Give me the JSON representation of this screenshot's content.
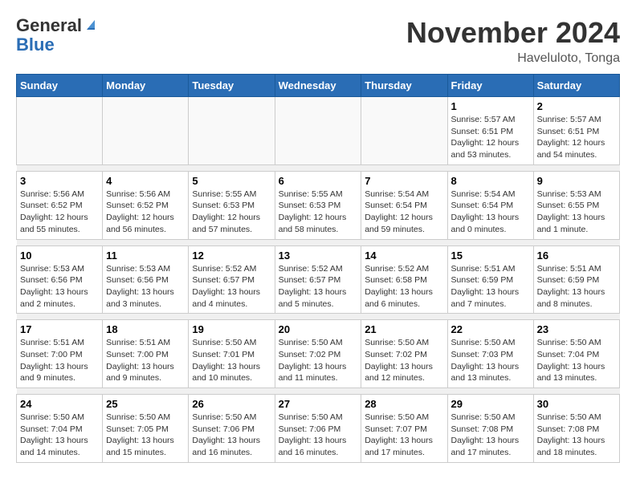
{
  "header": {
    "logo_general": "General",
    "logo_blue": "Blue",
    "month_title": "November 2024",
    "location": "Haveluloto, Tonga"
  },
  "weekdays": [
    "Sunday",
    "Monday",
    "Tuesday",
    "Wednesday",
    "Thursday",
    "Friday",
    "Saturday"
  ],
  "weeks": [
    [
      {
        "day": "",
        "info": ""
      },
      {
        "day": "",
        "info": ""
      },
      {
        "day": "",
        "info": ""
      },
      {
        "day": "",
        "info": ""
      },
      {
        "day": "",
        "info": ""
      },
      {
        "day": "1",
        "info": "Sunrise: 5:57 AM\nSunset: 6:51 PM\nDaylight: 12 hours and 53 minutes."
      },
      {
        "day": "2",
        "info": "Sunrise: 5:57 AM\nSunset: 6:51 PM\nDaylight: 12 hours and 54 minutes."
      }
    ],
    [
      {
        "day": "3",
        "info": "Sunrise: 5:56 AM\nSunset: 6:52 PM\nDaylight: 12 hours and 55 minutes."
      },
      {
        "day": "4",
        "info": "Sunrise: 5:56 AM\nSunset: 6:52 PM\nDaylight: 12 hours and 56 minutes."
      },
      {
        "day": "5",
        "info": "Sunrise: 5:55 AM\nSunset: 6:53 PM\nDaylight: 12 hours and 57 minutes."
      },
      {
        "day": "6",
        "info": "Sunrise: 5:55 AM\nSunset: 6:53 PM\nDaylight: 12 hours and 58 minutes."
      },
      {
        "day": "7",
        "info": "Sunrise: 5:54 AM\nSunset: 6:54 PM\nDaylight: 12 hours and 59 minutes."
      },
      {
        "day": "8",
        "info": "Sunrise: 5:54 AM\nSunset: 6:54 PM\nDaylight: 13 hours and 0 minutes."
      },
      {
        "day": "9",
        "info": "Sunrise: 5:53 AM\nSunset: 6:55 PM\nDaylight: 13 hours and 1 minute."
      }
    ],
    [
      {
        "day": "10",
        "info": "Sunrise: 5:53 AM\nSunset: 6:56 PM\nDaylight: 13 hours and 2 minutes."
      },
      {
        "day": "11",
        "info": "Sunrise: 5:53 AM\nSunset: 6:56 PM\nDaylight: 13 hours and 3 minutes."
      },
      {
        "day": "12",
        "info": "Sunrise: 5:52 AM\nSunset: 6:57 PM\nDaylight: 13 hours and 4 minutes."
      },
      {
        "day": "13",
        "info": "Sunrise: 5:52 AM\nSunset: 6:57 PM\nDaylight: 13 hours and 5 minutes."
      },
      {
        "day": "14",
        "info": "Sunrise: 5:52 AM\nSunset: 6:58 PM\nDaylight: 13 hours and 6 minutes."
      },
      {
        "day": "15",
        "info": "Sunrise: 5:51 AM\nSunset: 6:59 PM\nDaylight: 13 hours and 7 minutes."
      },
      {
        "day": "16",
        "info": "Sunrise: 5:51 AM\nSunset: 6:59 PM\nDaylight: 13 hours and 8 minutes."
      }
    ],
    [
      {
        "day": "17",
        "info": "Sunrise: 5:51 AM\nSunset: 7:00 PM\nDaylight: 13 hours and 9 minutes."
      },
      {
        "day": "18",
        "info": "Sunrise: 5:51 AM\nSunset: 7:00 PM\nDaylight: 13 hours and 9 minutes."
      },
      {
        "day": "19",
        "info": "Sunrise: 5:50 AM\nSunset: 7:01 PM\nDaylight: 13 hours and 10 minutes."
      },
      {
        "day": "20",
        "info": "Sunrise: 5:50 AM\nSunset: 7:02 PM\nDaylight: 13 hours and 11 minutes."
      },
      {
        "day": "21",
        "info": "Sunrise: 5:50 AM\nSunset: 7:02 PM\nDaylight: 13 hours and 12 minutes."
      },
      {
        "day": "22",
        "info": "Sunrise: 5:50 AM\nSunset: 7:03 PM\nDaylight: 13 hours and 13 minutes."
      },
      {
        "day": "23",
        "info": "Sunrise: 5:50 AM\nSunset: 7:04 PM\nDaylight: 13 hours and 13 minutes."
      }
    ],
    [
      {
        "day": "24",
        "info": "Sunrise: 5:50 AM\nSunset: 7:04 PM\nDaylight: 13 hours and 14 minutes."
      },
      {
        "day": "25",
        "info": "Sunrise: 5:50 AM\nSunset: 7:05 PM\nDaylight: 13 hours and 15 minutes."
      },
      {
        "day": "26",
        "info": "Sunrise: 5:50 AM\nSunset: 7:06 PM\nDaylight: 13 hours and 16 minutes."
      },
      {
        "day": "27",
        "info": "Sunrise: 5:50 AM\nSunset: 7:06 PM\nDaylight: 13 hours and 16 minutes."
      },
      {
        "day": "28",
        "info": "Sunrise: 5:50 AM\nSunset: 7:07 PM\nDaylight: 13 hours and 17 minutes."
      },
      {
        "day": "29",
        "info": "Sunrise: 5:50 AM\nSunset: 7:08 PM\nDaylight: 13 hours and 17 minutes."
      },
      {
        "day": "30",
        "info": "Sunrise: 5:50 AM\nSunset: 7:08 PM\nDaylight: 13 hours and 18 minutes."
      }
    ]
  ]
}
